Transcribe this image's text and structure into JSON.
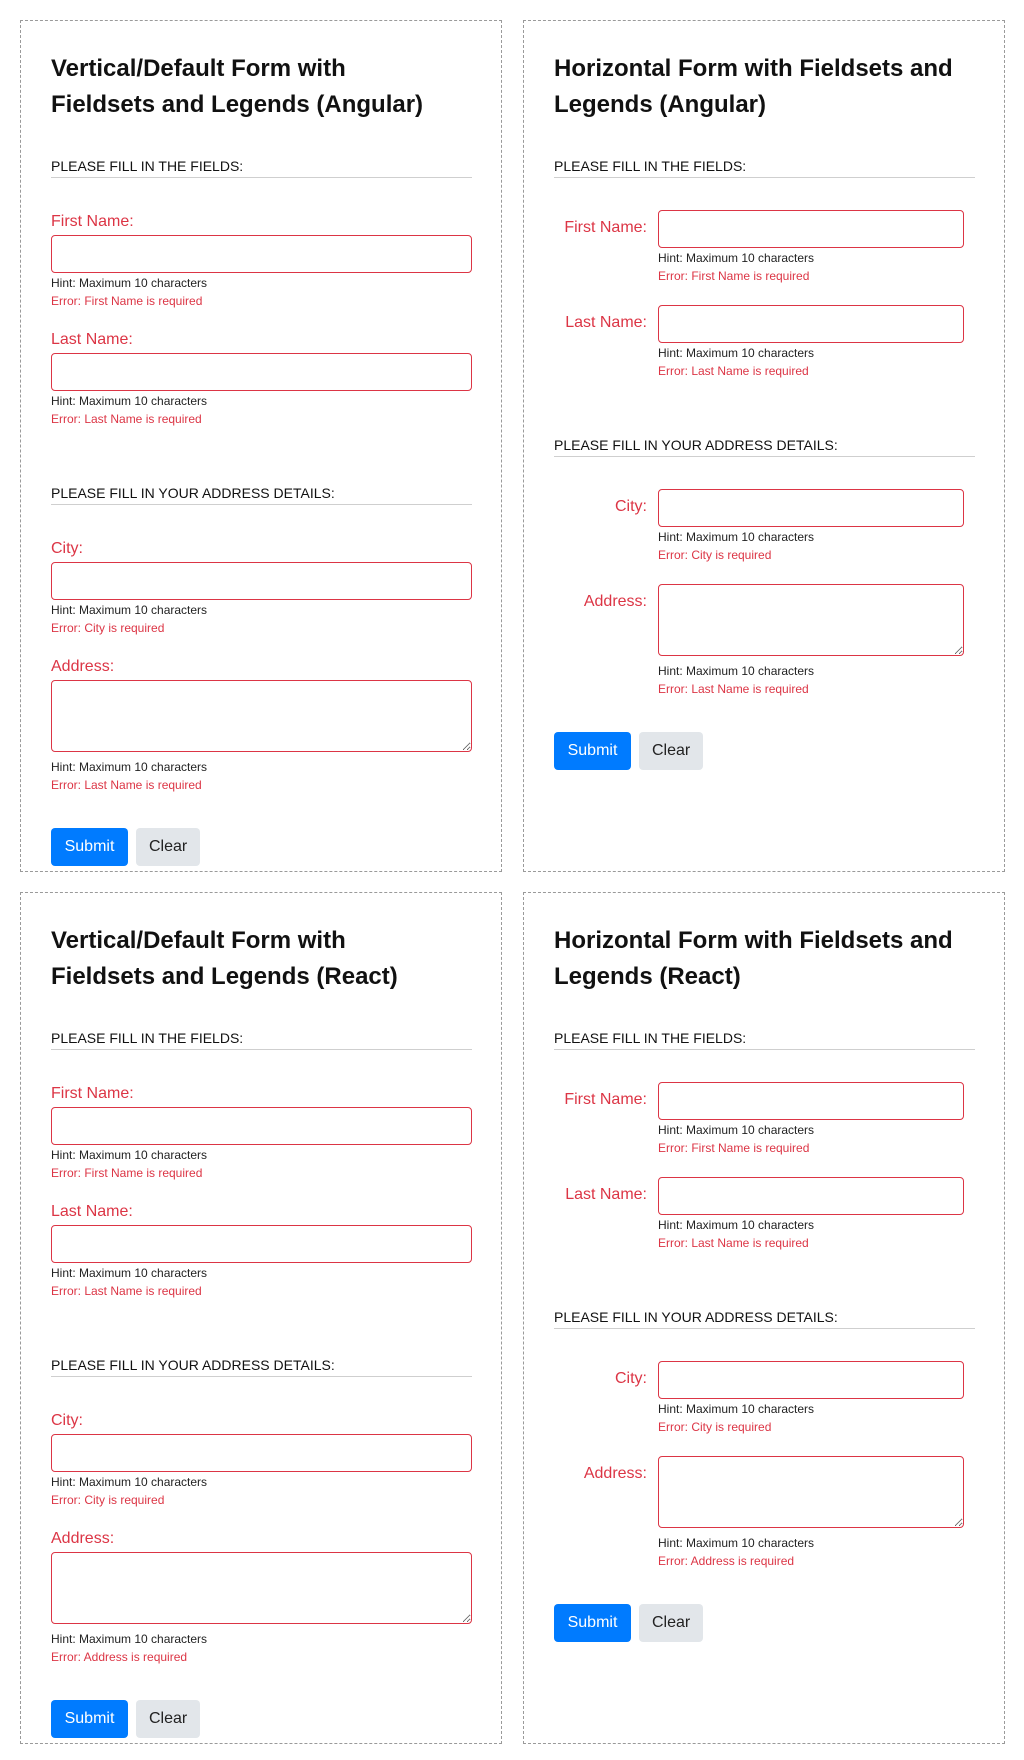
{
  "common": {
    "legend_personal": "Please fill in the fields:",
    "legend_address": "Please fill in your address details:",
    "first_name_label": "First Name:",
    "last_name_label": "Last Name:",
    "city_label": "City:",
    "address_label": "Address:",
    "hint": "Hint: Maximum 10 characters",
    "err_first": "Error: First Name is required",
    "err_last": "Error: Last Name is required",
    "err_city": "Error: City is required",
    "err_address": "Error: Address is required",
    "submit_label": "Submit",
    "clear_label": "Clear"
  },
  "panels": [
    {
      "title": "Vertical/Default Form with Fieldsets and Legends (Angular)",
      "address_error": "Error: Last Name is required"
    },
    {
      "title": "Horizontal Form with Fieldsets and Legends (Angular)",
      "address_error": "Error: Last Name is required"
    },
    {
      "title": "Vertical/Default Form with Fieldsets and Legends (React)",
      "address_error": "Error: Address is required"
    },
    {
      "title": "Horizontal Form with Fieldsets and Legends (React)",
      "address_error": "Error: Address is required"
    }
  ],
  "colors": {
    "error": "#dc3545",
    "primary": "#007bff",
    "secondary": "#e2e6ea"
  }
}
